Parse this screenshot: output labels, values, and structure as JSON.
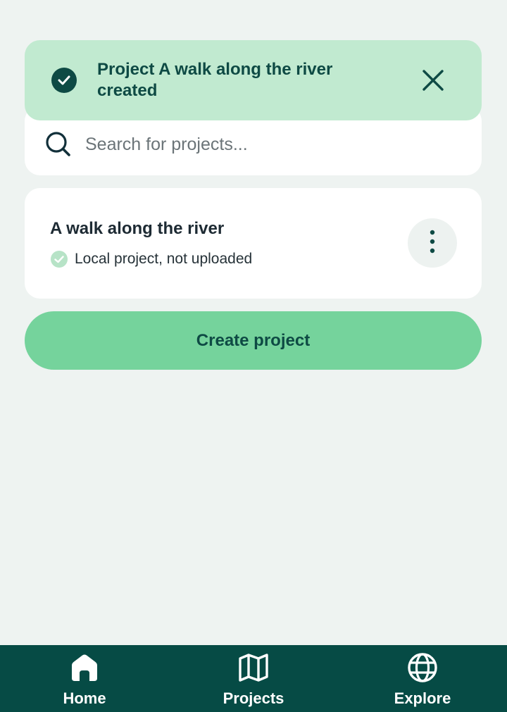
{
  "search": {
    "placeholder": "Search for projects...",
    "icon": "search-icon"
  },
  "toast": {
    "message": "Project A walk along the river created",
    "icon": "check-circle-icon",
    "close_icon": "close-icon"
  },
  "project": {
    "title": "A walk along the river",
    "status": "Local project, not uploaded",
    "status_icon": "check-circle-icon",
    "more_icon": "more-vertical-icon"
  },
  "create_button": {
    "label": "Create project"
  },
  "nav": {
    "items": [
      {
        "label": "Home",
        "icon": "home-icon",
        "active": true
      },
      {
        "label": "Projects",
        "icon": "map-icon",
        "active": false
      },
      {
        "label": "Explore",
        "icon": "globe-icon",
        "active": false
      }
    ]
  },
  "colors": {
    "background": "#eef3f1",
    "toast_bg": "#c1ead0",
    "primary_dark": "#0e4a44",
    "accent_green": "#75d39c",
    "nav_bg": "#064b45"
  }
}
